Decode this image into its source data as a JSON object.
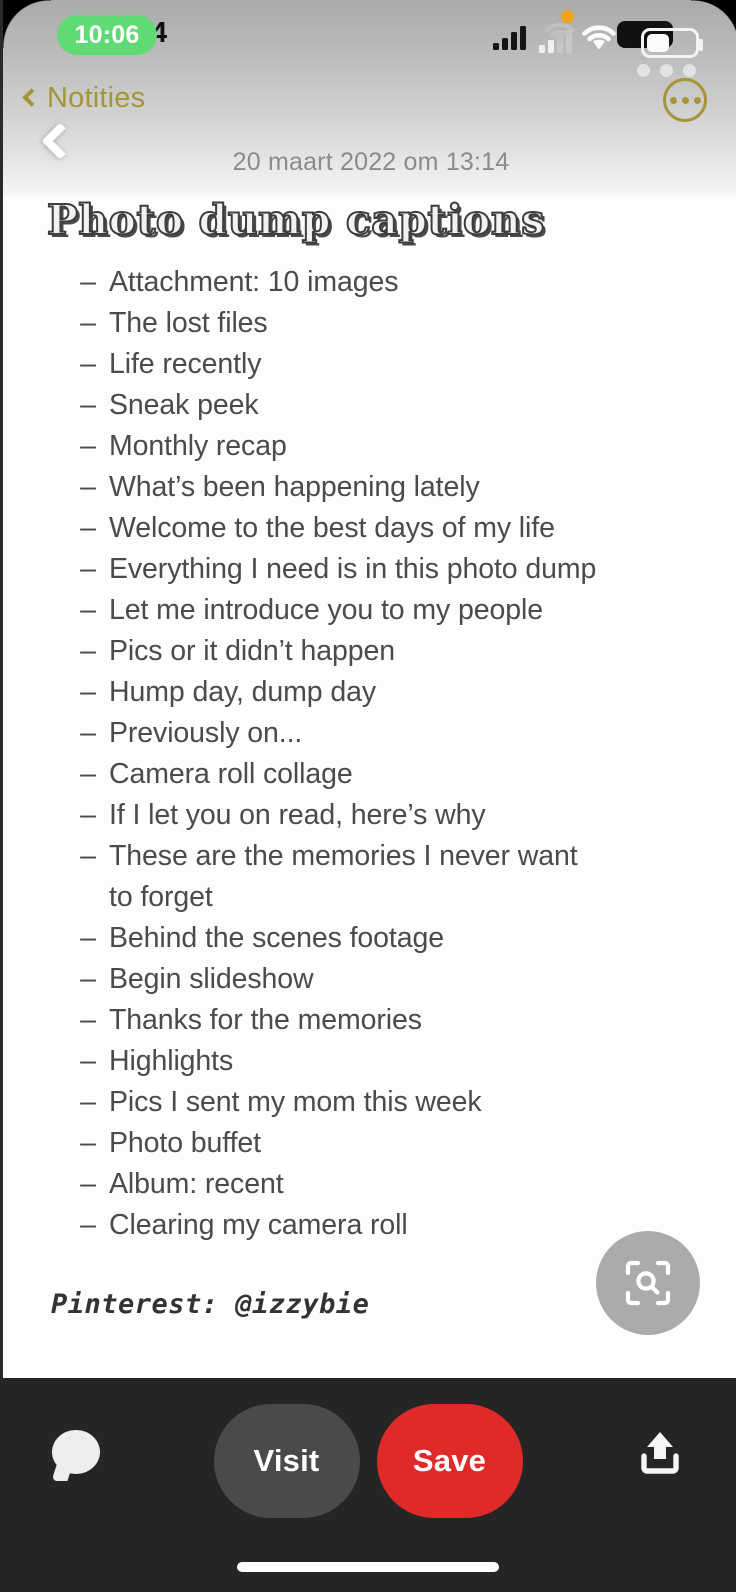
{
  "status_bar": {
    "time": "10:06",
    "ghost_time_fragment": "4",
    "icons": {
      "cellular": "cellular-signal-icon",
      "wifi": "wifi-icon",
      "battery": "battery-icon",
      "recording_indicator": "orange-recording-dot-icon"
    }
  },
  "notes_nav": {
    "back_label": "Notities",
    "back_icon": "chevron-left-icon",
    "more_icon": "more-options-icon"
  },
  "note": {
    "date": "20 maart 2022 om 13:14",
    "title": "Photo dump captions",
    "dash": "–",
    "items": [
      "Attachment: 10 images",
      "The lost files",
      "Life recently",
      "Sneak peek",
      "Monthly recap",
      "What’s been happening lately",
      "Welcome to the best days of my life",
      "Everything I need is in this photo dump",
      "Let me introduce you to my people",
      "Pics or it didn’t happen",
      "Hump day, dump day",
      "Previously on...",
      "Camera roll collage",
      "If I let you on read, here’s why",
      "These are the memories I never want to forget",
      "Behind the scenes footage",
      "Begin slideshow",
      "Thanks for the memories",
      "Highlights",
      "Pics I sent my mom this week",
      "Photo buffet",
      "Album: recent",
      "Clearing my camera roll"
    ],
    "signature": "Pinterest: @izzybie"
  },
  "overlays": {
    "back_icon": "chevron-left-icon",
    "visual_search_icon": "visual-search-lens-icon"
  },
  "action_bar": {
    "comment_icon": "comment-bubble-icon",
    "visit_label": "Visit",
    "save_label": "Save",
    "share_icon": "share-upload-icon"
  },
  "colors": {
    "save_red": "#e02a2a",
    "visit_grey": "#4a4a4a",
    "bar_background": "#252525",
    "time_pill_green": "#60da74",
    "notes_gold": "#a59536",
    "lens_button_grey": "#ababab"
  }
}
